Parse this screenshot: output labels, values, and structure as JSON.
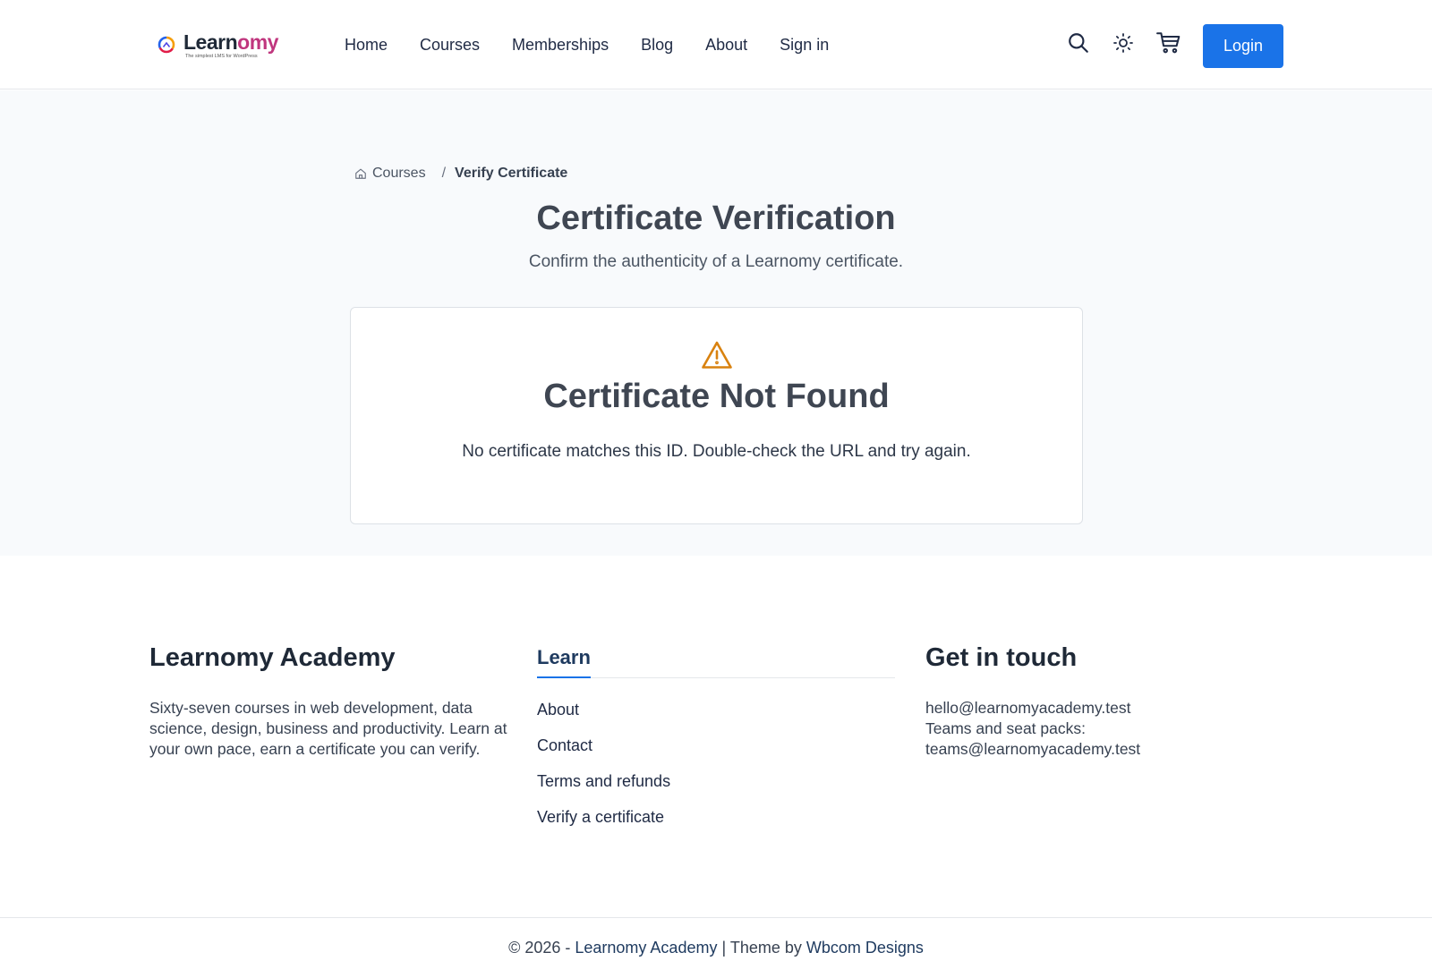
{
  "header": {
    "logo": {
      "name_part1": "Learn",
      "name_part2": "omy",
      "tagline": "The simplest LMS for WordPress"
    },
    "nav": [
      "Home",
      "Courses",
      "Memberships",
      "Blog",
      "About",
      "Sign in"
    ],
    "icons": [
      "search-icon",
      "sun-icon",
      "cart-icon"
    ],
    "login_label": "Login",
    "colors": {
      "accent": "#1a73e8",
      "logo_accent": "#c0367e"
    }
  },
  "breadcrumb": {
    "home": "Courses",
    "separator": "/",
    "current": "Verify Certificate"
  },
  "page": {
    "title": "Certificate Verification",
    "subtitle": "Confirm the authenticity of a Learnomy certificate."
  },
  "result": {
    "icon": "warning-icon",
    "icon_color": "#d9820f",
    "title": "Certificate Not Found",
    "message": "No certificate matches this ID. Double-check the URL and try again."
  },
  "footer": {
    "about": {
      "title": "Learnomy Academy",
      "text": "Sixty-seven courses in web development, data science, design, business and productivity. Learn at your own pace, earn a certificate you can verify."
    },
    "learn": {
      "title": "Learn",
      "links": [
        "About",
        "Contact",
        "Terms and refunds",
        "Verify a certificate"
      ]
    },
    "contact": {
      "title": "Get in touch",
      "email": "hello@learnomyacademy.test",
      "teams_label": "Teams and seat packs:",
      "teams_email": "teams@learnomyacademy.test"
    },
    "copyright": {
      "prefix": "© 2026 - ",
      "site": "Learnomy Academy",
      "divider": " | ",
      "theme_by": "Theme by ",
      "theme_author": "Wbcom Designs"
    }
  }
}
